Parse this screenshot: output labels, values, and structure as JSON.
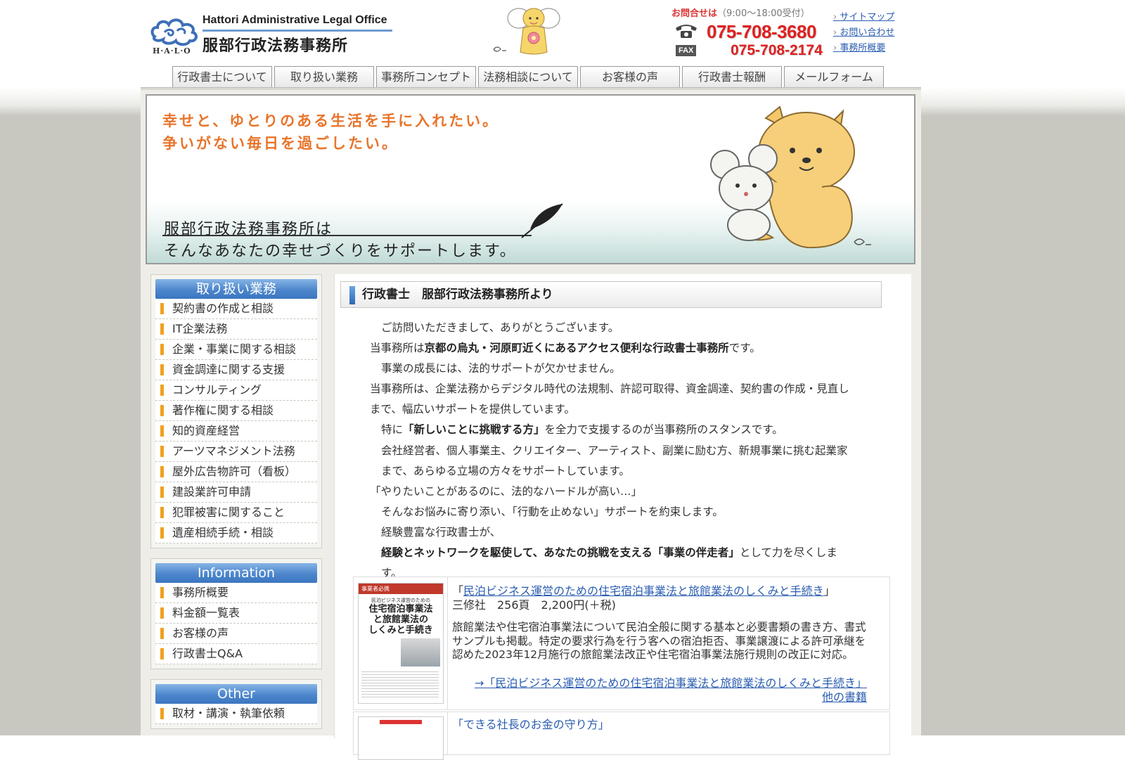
{
  "header": {
    "logo_letters": "H·A·L·O",
    "logo_en": "Hattori Administrative Legal Office",
    "logo_ja": "服部行政法務事務所",
    "contact_label": "お問合せは",
    "contact_hours": "（9:00～18:00受付）",
    "tel": "075-708-3680",
    "fax_label": "FAX",
    "fax": "075-708-2174",
    "quick_links": [
      "サイトマップ",
      "お問い合わせ",
      "事務所概要"
    ]
  },
  "nav": {
    "tabs": [
      "行政書士について",
      "取り扱い業務",
      "事務所コンセプト",
      "法務相談について",
      "お客様の声",
      "行政書士報酬",
      "メールフォーム"
    ]
  },
  "hero": {
    "tagline_1": "幸せと、ゆとりのある生活を手に入れたい。",
    "tagline_2": "争いがない毎日を過ごしたい。",
    "message_1": "服部行政法務事務所は",
    "message_2": "そんなあなたの幸せづくりをサポートします。"
  },
  "sidebar": {
    "services": {
      "title": "取り扱い業務",
      "items": [
        "契約書の作成と相談",
        "IT企業法務",
        "企業・事業に関する相談",
        "資金調達に関する支援",
        "コンサルティング",
        "著作権に関する相談",
        "知的資産経営",
        "アーツマネジメント法務",
        "屋外広告物許可（看板）",
        "建設業許可申請",
        "犯罪被害に関すること",
        "遺産相続手続・相談"
      ]
    },
    "information": {
      "title": "Information",
      "items": [
        "事務所概要",
        "料金額一覧表",
        "お客様の声",
        "行政書士Q&A"
      ]
    },
    "other": {
      "title": "Other",
      "items": [
        "取材・講演・執筆依頼"
      ]
    }
  },
  "content": {
    "title": "行政書士　服部行政法務事務所より",
    "p1": "ご訪問いただきまして、ありがとうございます。",
    "p2_pre": "当事務所は",
    "p2_bold": "京都の烏丸・河原町近くにあるアクセス便利な行政書士事務所",
    "p2_post": "です。",
    "p3": "事業の成長には、法的サポートが欠かせません。",
    "p4": "当事務所は、企業法務からデジタル時代の法規制、許認可取得、資金調達、契約書の作成・見直しまで、幅広いサポートを提供しています。",
    "p5_pre": "特に",
    "p5_bold": "「新しいことに挑戦する方」",
    "p5_post": "を全力で支援するのが当事務所のスタンスです。",
    "p6": "会社経営者、個人事業主、クリエイター、アーティスト、副業に励む方、新規事業に挑む起業家まで、あらゆる立場の方々をサポートしています。",
    "p7": "「やりたいことがあるのに、法的なハードルが高い…」",
    "p8": "そんなお悩みに寄り添い、「行動を止めない」サポートを約束します。",
    "p9_pre": "経験豊富な行政書士が、",
    "p9_bold": "経験とネットワークを駆使して、あなたの挑戦を支える「事業の伴走者」",
    "p9_post": "として力を尽くします。"
  },
  "book": {
    "title_open": "「",
    "title_link": "民泊ビジネス運営のための住宅宿泊事業法と旅館業法のしくみと手続き",
    "title_close": "」",
    "publisher": "三修社　256頁　2,200円(＋税)",
    "description": "旅館業法や住宅宿泊事業法について民泊全般に関する基本と必要書類の書き方、書式サンプルも掲載。特定の要求行為を行う客への宿泊拒否、事業譲渡による許可承継を認めた2023年12月施行の旅館業法改正や住宅宿泊事業法施行規則の改正に対応。",
    "more_link": "→「民泊ビジネス運営のための住宅宿泊事業法と旅館業法のしくみと手続き」他の書籍",
    "cover_lines": [
      "事業者必携",
      "民泊ビジネス運営のための",
      "住宅宿泊事業法",
      "と旅館業法の",
      "しくみと手続き"
    ]
  },
  "book2": {
    "title": "「できる社長のお金の守り方」"
  },
  "colors": {
    "accent_blue": "#4d86cc",
    "tel_red": "#e02020",
    "hero_orange": "#e8742a",
    "bullet_orange": "#f0a020",
    "link_blue": "#2a5db0"
  }
}
